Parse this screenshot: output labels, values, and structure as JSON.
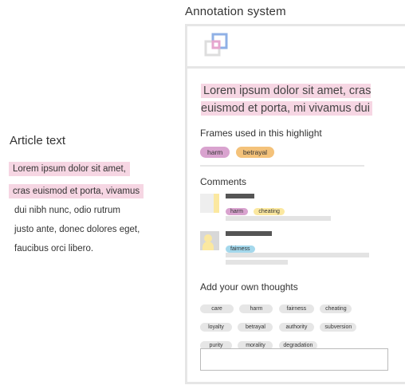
{
  "article": {
    "title": "Article text",
    "highlighted_lines": [
      "Lorem ipsum dolor sit amet,",
      "cras euismod et porta, vivamus"
    ],
    "plain_lines": [
      "dui nibh nunc, odio rutrum",
      "justo ante, donec dolores eget,",
      "faucibus orci libero."
    ]
  },
  "annotation": {
    "title": "Annotation system",
    "logo_icon": "overlapping-squares-logo",
    "highlight_quote": "Lorem ipsum dolor sit amet, cras euismod et porta, mi vivamus dui",
    "frames_label": "Frames used in this highlight",
    "frames": [
      "harm",
      "betrayal"
    ],
    "comments_label": "Comments",
    "comments": [
      {
        "avatar": "avatar-icon",
        "tags": [
          "harm",
          "cheating"
        ]
      },
      {
        "avatar": "avatar-icon",
        "tags": [
          "fairness"
        ]
      }
    ],
    "add_label": "Add your own thoughts",
    "chips": [
      "care",
      "harm",
      "fairness",
      "cheating",
      "loyalty",
      "betrayal",
      "authority",
      "subversion",
      "purity",
      "morality",
      "degradation"
    ],
    "input": {
      "value": "",
      "placeholder": ""
    }
  },
  "colors": {
    "highlight": "#f6d6e3",
    "harm": "#d9a3cf",
    "betrayal": "#f4c27a",
    "cheating": "#fbe8a0",
    "fairness": "#a4d8ec",
    "chip": "#e6e6e6",
    "border": "#e6e6e6"
  }
}
